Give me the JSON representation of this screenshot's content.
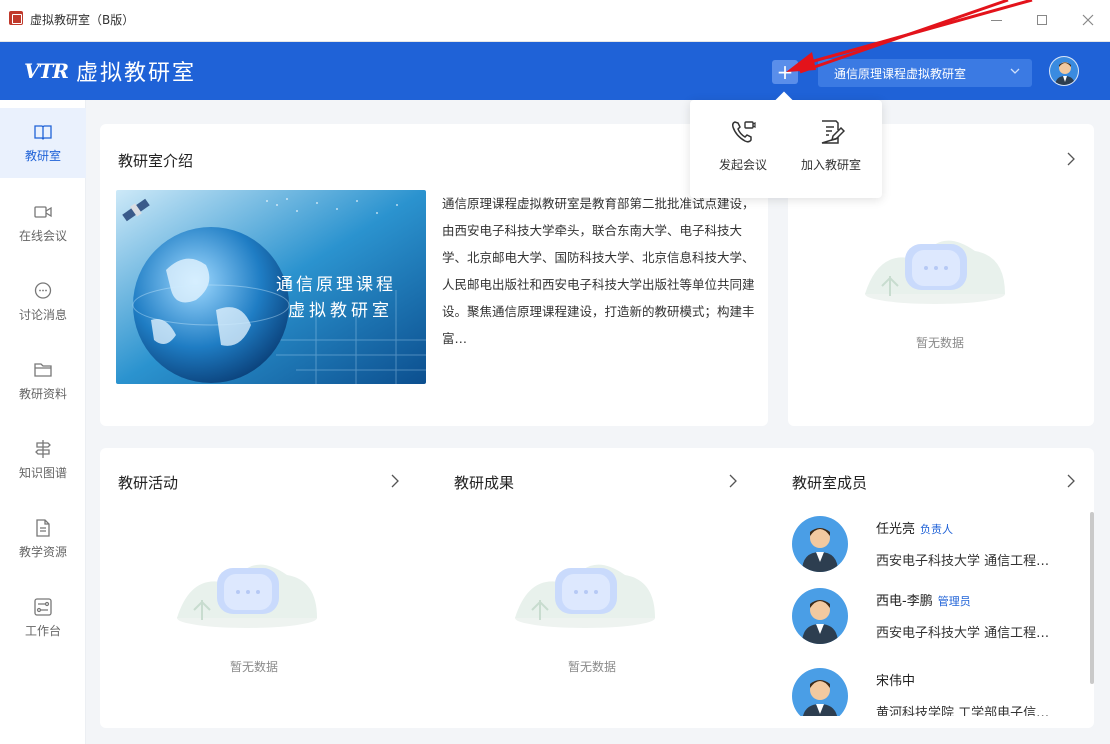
{
  "window": {
    "title": "虚拟教研室（B版）",
    "controls": [
      "minimize-icon",
      "maximize-icon",
      "close-icon"
    ]
  },
  "header": {
    "logo_mark": "VTR",
    "logo_text": "虚拟教研室",
    "plus_label": "+",
    "room_select": "通信原理课程虚拟教研室",
    "brand_color": "#1f62d7"
  },
  "popover": {
    "items": [
      {
        "label": "发起会议",
        "icon": "phone-meeting-icon"
      },
      {
        "label": "加入教研室",
        "icon": "edit-document-icon"
      }
    ]
  },
  "sidebar": {
    "items": [
      {
        "label": "教研室",
        "icon": "book-icon",
        "active": true
      },
      {
        "label": "在线会议",
        "icon": "video-icon"
      },
      {
        "label": "讨论消息",
        "icon": "chat-bubble-icon"
      },
      {
        "label": "教研资料",
        "icon": "folder-icon"
      },
      {
        "label": "知识图谱",
        "icon": "signpost-icon"
      },
      {
        "label": "教学资源",
        "icon": "document-icon"
      },
      {
        "label": "工作台",
        "icon": "workbench-icon"
      }
    ]
  },
  "intro": {
    "title": "教研室介绍",
    "image_caption_1": "通信原理课程",
    "image_caption_2": "虚拟教研室",
    "text": "通信原理课程虚拟教研室是教育部第二批批准试点建设，由西安电子科技大学牵头，联合东南大学、电子科技大学、北京邮电大学、国防科技大学、北京信息科技大学、人民邮电出版社和西安电子科技大学出版社等单位共同建设。聚焦通信原理课程建设，打造新的教研模式；构建丰富…"
  },
  "right_top": {
    "empty_label": "暂无数据"
  },
  "activities": {
    "title": "教研活动",
    "empty_label": "暂无数据"
  },
  "results": {
    "title": "教研成果",
    "empty_label": "暂无数据"
  },
  "members": {
    "title": "教研室成员",
    "list": [
      {
        "name": "任光亮",
        "role": "负责人",
        "org": "西安电子科技大学 通信工程…"
      },
      {
        "name": "西电-李鹏",
        "role": "管理员",
        "org": "西安电子科技大学 通信工程…"
      },
      {
        "name": "宋伟中",
        "role": "",
        "org": "黄河科技学院 工学部电子信…"
      }
    ]
  }
}
